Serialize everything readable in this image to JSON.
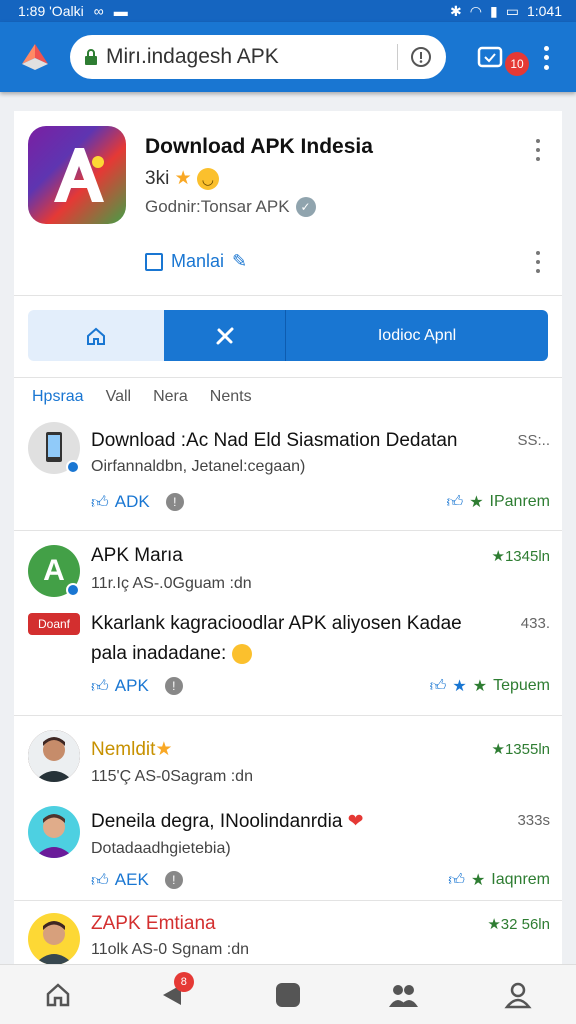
{
  "status_bar": {
    "left_text": "1:89 'Oalki",
    "right_time": "1:041"
  },
  "browser": {
    "url": "Mirı.indagesh APK",
    "tab_count": "10"
  },
  "app": {
    "title": "Download APK Indesia",
    "rating": "3ki",
    "developer": "Godnir:Tonsar APK",
    "manage": "Manlai"
  },
  "segment": {
    "main_label": "Iodioc Apnl"
  },
  "filter_tabs": [
    "Hpsraa",
    "Vall",
    "Nera",
    "Nents"
  ],
  "feed": [
    {
      "title": "Download :Ac Nad Eld Siasmation Dedatan",
      "subtitle": "Oirfannaldbn, Jetanel:cegaan)",
      "time": "SS:..",
      "like_label": "ADK",
      "reaction_label": "IPanrem"
    },
    {
      "title": "APK Marıa",
      "subtitle": "11r.Iç AS-.0Gguam :dn",
      "time": "★1345ln",
      "chip": "Doanf",
      "post_line1": "Kkarlank kagracioodlar APK aliyosen Kadae",
      "post_line2": "pala inadadane:",
      "post_time": "433.",
      "like_label": "APK",
      "reaction_label": "Tepuem"
    },
    {
      "title": "Nemldit",
      "subtitle": "115'Ç AS-0Sagram :dn",
      "time": "★1355ln"
    },
    {
      "title": "Deneila degra, INoolindanrdia",
      "subtitle": "Dotadaadhgietebia)",
      "time": "333s",
      "like_label": "AEK",
      "reaction_label": "Iaqnrem"
    },
    {
      "title": "ZAPK Emtiana",
      "subtitle": "11olk AS-0 Sgnam :dn",
      "time": "★32 56ln"
    }
  ],
  "bottom_nav": {
    "badge": "8"
  },
  "colors": {
    "primary": "#1976d2",
    "green": "#2e7d32",
    "red": "#d32f2f"
  }
}
